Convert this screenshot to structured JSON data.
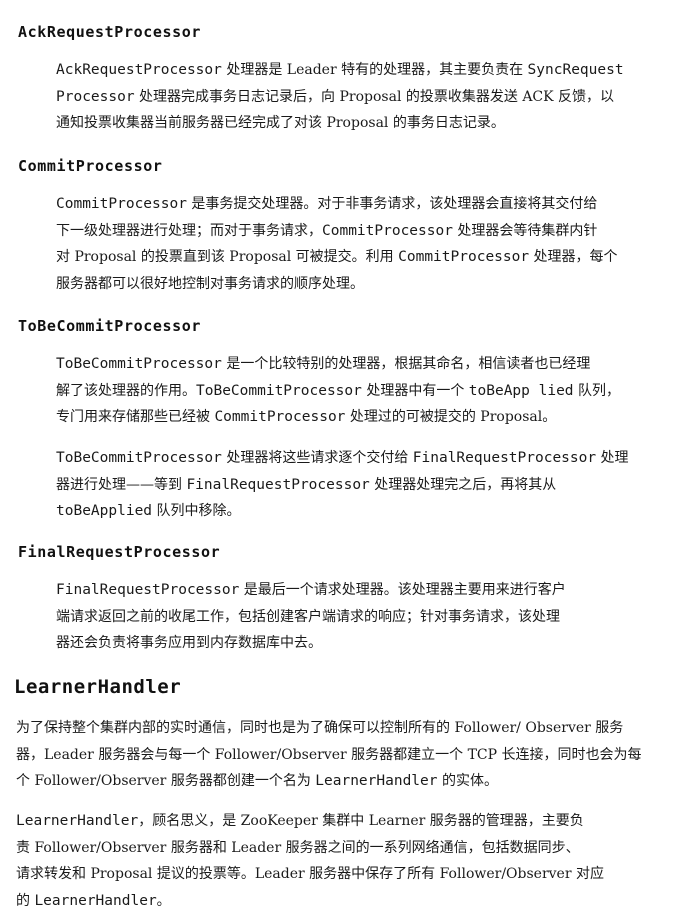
{
  "sections": [
    {
      "heading": "AckRequestProcessor",
      "paragraphs": [
        {
          "lines": [
            [
              {
                "code": "AckRequestProcessor"
              },
              {
                "text": " 处理器是 Leader 特有的处理器，其主要负责在 "
              },
              {
                "code": "SyncRequest"
              }
            ],
            [
              {
                "code": "Processor"
              },
              {
                "text": " 处理器完成事务日志记录后，向 Proposal 的投票收集器发送 ACK 反馈，以"
              }
            ],
            [
              {
                "text": "通知投票收集器当前服务器已经完成了对该 Proposal 的事务日志记录。"
              }
            ]
          ]
        }
      ]
    },
    {
      "heading": "CommitProcessor",
      "paragraphs": [
        {
          "lines": [
            [
              {
                "code": "CommitProcessor"
              },
              {
                "text": " 是事务提交处理器。对于非事务请求，该处理器会直接将其交付给"
              }
            ],
            [
              {
                "text": "下一级处理器进行处理；而对于事务请求，"
              },
              {
                "code": "CommitProcessor"
              },
              {
                "text": " 处理器会等待集群内针"
              }
            ],
            [
              {
                "text": "对 Proposal 的投票直到该 Proposal 可被提交。利用 "
              },
              {
                "code": "CommitProcessor"
              },
              {
                "text": " 处理器，每个"
              }
            ],
            [
              {
                "text": "服务器都可以很好地控制对事务请求的顺序处理。"
              }
            ]
          ]
        }
      ]
    },
    {
      "heading": "ToBeCommitProcessor",
      "paragraphs": [
        {
          "lines": [
            [
              {
                "code": "ToBeCommitProcessor"
              },
              {
                "text": " 是一个比较特别的处理器，根据其命名，相信读者也已经理"
              }
            ],
            [
              {
                "text": "解了该处理器的作用。"
              },
              {
                "code": "ToBeCommitProcessor"
              },
              {
                "text": " 处理器中有一个 "
              },
              {
                "code": "toBeApp lied"
              },
              {
                "text": " 队列，"
              }
            ],
            [
              {
                "text": "专门用来存储那些已经被 "
              },
              {
                "code": "CommitProcessor"
              },
              {
                "text": " 处理过的可被提交的 Proposal。"
              }
            ]
          ]
        },
        {
          "lines": [
            [
              {
                "code": "ToBeCommitProcessor"
              },
              {
                "text": " 处理器将这些请求逐个交付给 "
              },
              {
                "code": "FinalRequestProcessor"
              },
              {
                "text": " 处理"
              }
            ],
            [
              {
                "text": "器进行处理——等到 "
              },
              {
                "code": "FinalRequestProcessor"
              },
              {
                "text": " 处理器处理完之后，再将其从"
              }
            ],
            [
              {
                "code": "toBeApplied"
              },
              {
                "text": " 队列中移除。"
              }
            ]
          ]
        }
      ]
    },
    {
      "heading": "FinalRequestProcessor",
      "paragraphs": [
        {
          "lines": [
            [
              {
                "code": "FinalRequestProcessor"
              },
              {
                "text": " 是最后一个请求处理器。该处理器主要用来进行客户"
              }
            ],
            [
              {
                "text": "端请求返回之前的收尾工作，包括创建客户端请求的响应；针对事务请求，该处理"
              }
            ],
            [
              {
                "text": "器还会负责将事务应用到内存数据库中去。"
              }
            ]
          ]
        }
      ]
    }
  ],
  "learner": {
    "heading": "LearnerHandler",
    "paragraphs": [
      {
        "lines": [
          [
            {
              "text": "为了保持整个集群内部的实时通信，同时也是为了确保可以控制所有的 Follower/ Observer 服务"
            }
          ],
          [
            {
              "text": "器，Leader 服务器会与每一个 Follower/Observer 服务器都建立一个 TCP 长连接，同时也会为每"
            }
          ],
          [
            {
              "text": "个 Follower/Observer 服务器都创建一个名为 "
            },
            {
              "code": "LearnerHandler"
            },
            {
              "text": " 的实体。"
            }
          ]
        ]
      },
      {
        "lines": [
          [
            {
              "code": "LearnerHandler"
            },
            {
              "text": "，顾名思义，是 ZooKeeper 集群中 Learner 服务器的管理器，主要负"
            }
          ],
          [
            {
              "text": "责 Follower/Observer 服务器和 Leader 服务器之间的一系列网络通信，包括数据同步、"
            }
          ],
          [
            {
              "text": "请求转发和 Proposal 提议的投票等。Leader 服务器中保存了所有 Follower/Observer 对应"
            }
          ],
          [
            {
              "text": "的 "
            },
            {
              "code": "LearnerHandler"
            },
            {
              "text": "。"
            }
          ]
        ]
      }
    ]
  }
}
